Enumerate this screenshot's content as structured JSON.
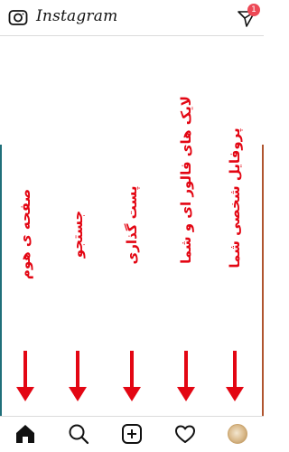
{
  "header": {
    "brand": "Instagram",
    "notification_count": "1"
  },
  "annotations": [
    {
      "id": "home",
      "text": "صفحه ی هوم"
    },
    {
      "id": "search",
      "text": "جستجو"
    },
    {
      "id": "post",
      "text": "پست گذاری"
    },
    {
      "id": "likes",
      "text": "لایک های فالور ای و شما"
    },
    {
      "id": "profile",
      "text": "پروفایل شخصی شما"
    }
  ],
  "bottom_nav": {
    "icons": [
      "home-icon",
      "search-icon",
      "add-post-icon",
      "heart-icon",
      "profile-avatar"
    ]
  },
  "colors": {
    "annotation": "#e30613",
    "badge": "#ed4956",
    "border": "#dbdbdb"
  }
}
